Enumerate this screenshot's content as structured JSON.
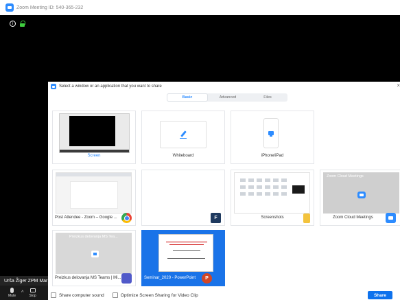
{
  "window": {
    "title": "Zoom Meeting ID: 540-365-232"
  },
  "participant": {
    "name": "Urša Žiger ZPM Mar"
  },
  "toolbar": {
    "mute_label": "Mute",
    "stop_label": "Stop"
  },
  "dialog": {
    "title": "Select a window or an application that you want to share",
    "close": "×",
    "tabs": [
      {
        "label": "Basic",
        "active": true
      },
      {
        "label": "Advanced",
        "active": false
      },
      {
        "label": "Files",
        "active": false
      }
    ],
    "tiles": [
      {
        "label": "Screen",
        "icon": "screen-icon"
      },
      {
        "label": "Whiteboard",
        "icon": "pen-icon"
      },
      {
        "label": "iPhone/iPad",
        "icon": "airplay-icon"
      },
      {
        "label": "Post Attendee - Zoom – Google ...",
        "icon": "chrome-icon"
      },
      {
        "label": "",
        "icon": "f-app-icon",
        "badge": "F"
      },
      {
        "label": "Screenshots",
        "icon": "folder-icon"
      },
      {
        "label": "Zoom Cloud Meetings",
        "icon": "zoom-icon",
        "thumb_title": "Zoom Cloud Meetings"
      },
      {
        "label": "Preizkus delovanja MS Teams | Mi...",
        "icon": "teams-icon",
        "thumb_title": "Preizkus delovanja MS Tea..."
      },
      {
        "label": "Seminar_2020 - PowerPoint",
        "icon": "powerpoint-icon",
        "badge": "P",
        "selected": true
      }
    ],
    "footer": {
      "share_sound_label": "Share computer sound",
      "optimize_label": "Optimize Screen Sharing for Video Clip",
      "share_button": "Share"
    }
  },
  "colors": {
    "accent": "#2d8cff",
    "share_button": "#0e72ed",
    "selected_tile": "#1a73e8"
  }
}
